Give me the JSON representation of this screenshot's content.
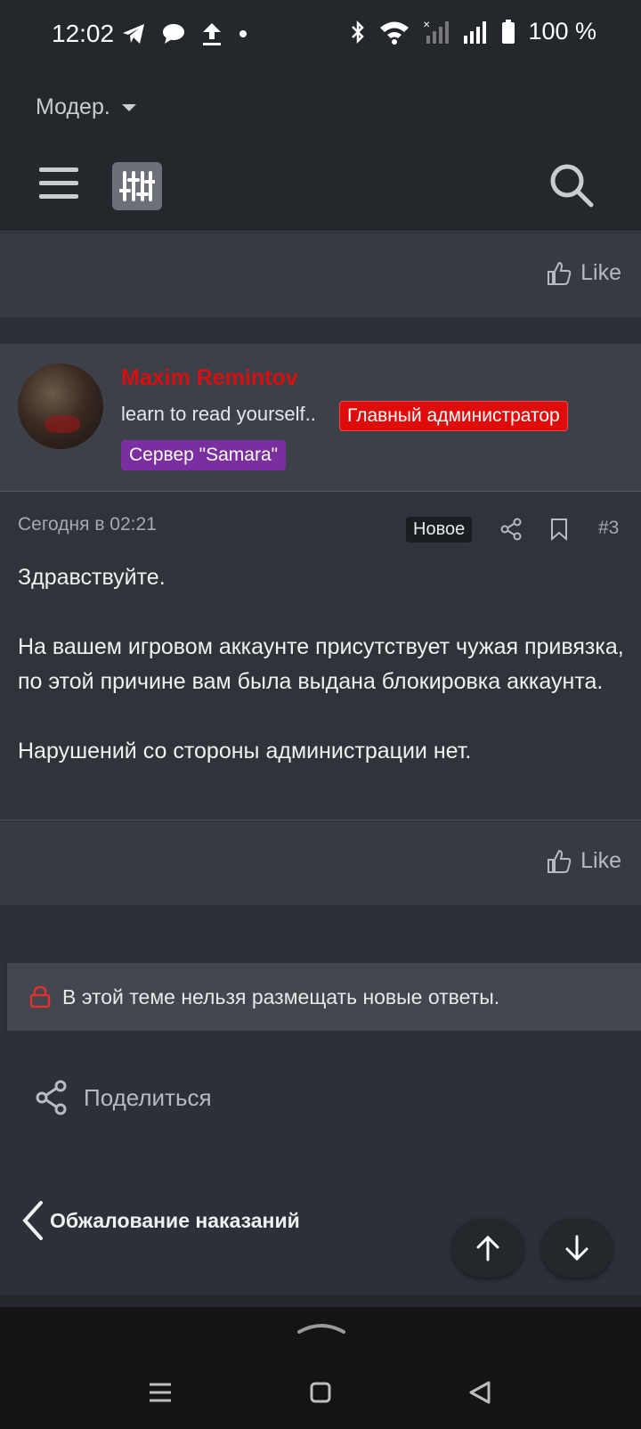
{
  "status_bar": {
    "time": "12:02",
    "battery_text": "100 %",
    "icons_left": [
      "telegram-icon",
      "message-icon",
      "upload-icon",
      "dot-icon"
    ],
    "icons_right": [
      "bluetooth-icon",
      "wifi-icon",
      "signal-empty-icon",
      "signal-full-icon",
      "battery-icon"
    ]
  },
  "header": {
    "mod_dropdown_label": "Модер.",
    "icons": [
      "menu-icon",
      "filter-icon",
      "search-icon"
    ]
  },
  "like_label_top": "Like",
  "post": {
    "author": {
      "name": "Maxim Remintov",
      "user_title": "learn to read yourself..",
      "role_badge": "Главный администратор",
      "server_badge": "Сервер \"Samara\""
    },
    "date": "Сегодня в 02:21",
    "new_badge": "Новое",
    "number": "#3",
    "paragraphs": [
      "Здравствуйте.",
      "На вашем игровом аккаунте присутствует чужая привязка, по этой причине вам была выдана блокировка аккаунта.",
      "Нарушений со стороны администрации нет."
    ],
    "like_label": "Like"
  },
  "locked_notice": "В этой теме нельзя размещать новые ответы.",
  "share_label": "Поделиться",
  "breadcrumb_label": "Обжалование наказаний",
  "colors": {
    "page_bg": "#2c3038",
    "header_bg": "#24272c",
    "author_name": "#d41010",
    "admin_badge": "#e00b0b",
    "server_badge": "#7b2ea0"
  }
}
